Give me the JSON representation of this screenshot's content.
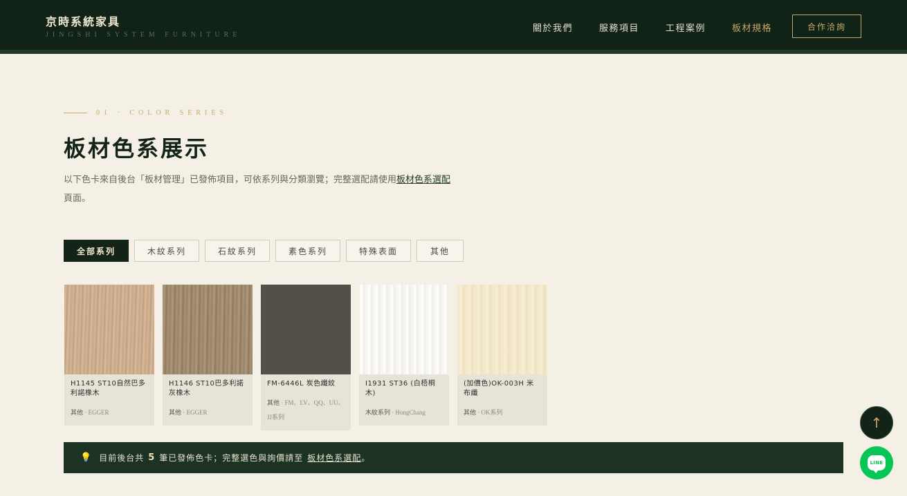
{
  "header": {
    "brand_zh": "京時系統家具",
    "brand_en": "JINGSHI SYSTEM FURNITURE",
    "nav": [
      {
        "label": "關於我們",
        "active": false
      },
      {
        "label": "服務項目",
        "active": false
      },
      {
        "label": "工程案例",
        "active": false
      },
      {
        "label": "板材規格",
        "active": true
      }
    ],
    "cta_label": "合作洽詢"
  },
  "section": {
    "eyebrow": "01 · COLOR SERIES",
    "title": "板材色系展示",
    "desc_before": "以下色卡來自後台「板材管理」已發佈項目，可依系列與分類瀏覽；完整選配請使用",
    "desc_link": "板材色系選配",
    "desc_after": "頁面。"
  },
  "tabs": [
    {
      "label": "全部系列",
      "active": true
    },
    {
      "label": "木紋系列",
      "active": false
    },
    {
      "label": "石紋系列",
      "active": false
    },
    {
      "label": "素色系列",
      "active": false
    },
    {
      "label": "特殊表面",
      "active": false
    },
    {
      "label": "其他",
      "active": false
    }
  ],
  "cards": [
    {
      "name": "H1145 ST10自然巴多利諾橡木",
      "category": "其他",
      "brand": " · EGGER",
      "swatch": "sw1"
    },
    {
      "name": "H1146 ST10巴多利諾灰橡木",
      "category": "其他",
      "brand": " · EGGER",
      "swatch": "sw2"
    },
    {
      "name": "FM-6446L 炭色纖紋",
      "category": "其他",
      "brand": " · FM、LV、QQ、UU、JJ系列",
      "swatch": "sw3"
    },
    {
      "name": "I1931 ST36 (白梧桐木)",
      "category": "木紋系列",
      "brand": " · HongChang",
      "swatch": "sw4"
    },
    {
      "name": "(加價色)OK-003H 米布纖",
      "category": "其他",
      "brand": " · OK系列",
      "swatch": "sw5"
    }
  ],
  "banner": {
    "icon": "lightbulb-icon",
    "before": "目前後台共",
    "count": "5",
    "middle": "筆已發佈色卡；完整選色與詢價請至",
    "link": "板材色系選配",
    "after": "。"
  },
  "fab": {
    "top_icon": "↑",
    "line_label": "LINE"
  },
  "colors": {
    "header_bg": "#112216",
    "accent_gold": "#c8a868",
    "page_bg": "#f4f0e6",
    "line_green": "#06c755"
  }
}
